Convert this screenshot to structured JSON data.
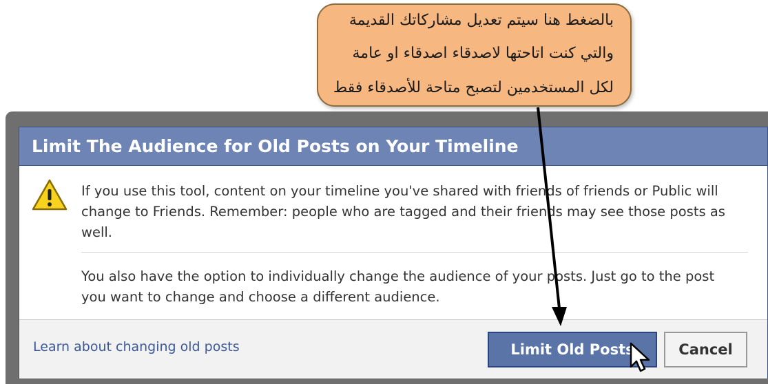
{
  "annotation": {
    "lines": [
      "بالضغط هنا سيتم تعديل مشاركاتك القديمة",
      "والتي كنت اتاحتها لاصدقاء اصدقاء او عامة",
      "لكل المستخدمين لتصبح متاحة للأصدقاء فقط"
    ]
  },
  "dialog": {
    "title": "Limit The Audience for Old Posts on Your Timeline",
    "warning_text": "If you use this tool, content on your timeline you've shared with friends of friends or Public will change to Friends. Remember: people who are tagged and their friends may see those posts as well.",
    "option_text": "You also have the option to individually change the audience of your posts. Just go to the post you want to change and choose a different audience.",
    "learn_link": "Learn about changing old posts",
    "primary_button": "Limit Old Posts",
    "cancel_button": "Cancel"
  },
  "icons": {
    "warning": "warning-triangle-icon",
    "cursor": "mouse-pointer-icon",
    "arrow": "annotation-arrow"
  },
  "colors": {
    "titlebar": "#6d84b4",
    "primary_button": "#5b74a8",
    "link": "#3b5998",
    "annotation_bubble": "#f6b880"
  }
}
